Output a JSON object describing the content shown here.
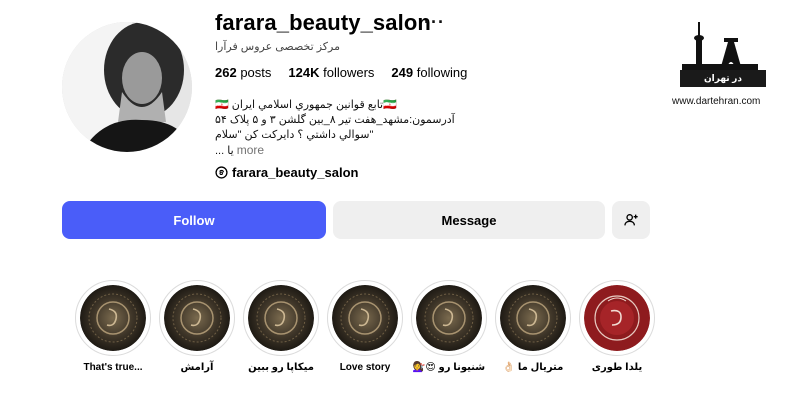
{
  "profile": {
    "username": "farara_beauty_salon",
    "options_glyph": "···",
    "category": "مرکز تخصصی عروس فرآرا",
    "stats": [
      {
        "num": "262",
        "label": "posts"
      },
      {
        "num": "124K",
        "label": "followers"
      },
      {
        "num": "249",
        "label": "following"
      }
    ],
    "bio_lines": [
      "🇮🇷 تابع قوانين جمهوري اسلامي ايران🇮🇷",
      "آدرسمون:مشهد_هفت تیر ۸_بین گلشن ۳ و ۵ پلاک ۵۴",
      "\"سوالي داشتي ؟ دايركت كن \"سلام",
      "يا ..."
    ],
    "more_label": "more",
    "threads_handle": "farara_beauty_salon"
  },
  "actions": {
    "follow": "Follow",
    "message": "Message",
    "add_person_icon": "add-person-icon"
  },
  "highlights": [
    {
      "label": "That's true..."
    },
    {
      "label": "آرامش"
    },
    {
      "label": "میکاپا رو ببین"
    },
    {
      "label": "Love story"
    },
    {
      "label": "شنیونا رو 😍💇‍♀️"
    },
    {
      "label": "متریال ما 👌🏻"
    },
    {
      "label": "یلدا طوری"
    }
  ],
  "watermark": {
    "brand": "در تهران",
    "url": "www.dartehran.com"
  },
  "colors": {
    "follow_button": "#4a5df9",
    "secondary_button": "#efefef",
    "muted_text": "#737373"
  }
}
